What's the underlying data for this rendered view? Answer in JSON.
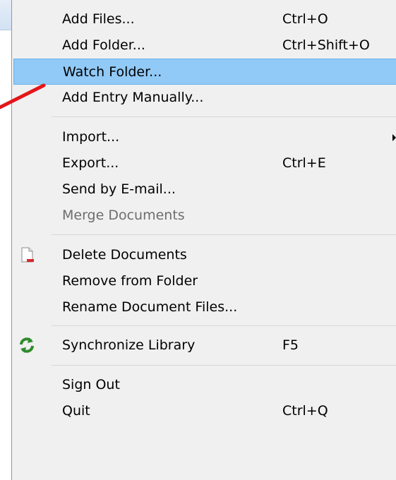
{
  "menu": {
    "items": [
      {
        "label": "Add Files...",
        "shortcut": "Ctrl+O"
      },
      {
        "label": "Add Folder...",
        "shortcut": "Ctrl+Shift+O"
      },
      {
        "label": "Watch Folder...",
        "shortcut": "",
        "state": "highlighted"
      },
      {
        "label": "Add Entry Manually...",
        "shortcut": ""
      },
      {
        "label": "Import...",
        "shortcut": "",
        "submenu": true
      },
      {
        "label": "Export...",
        "shortcut": "Ctrl+E"
      },
      {
        "label": "Send by E-mail...",
        "shortcut": ""
      },
      {
        "label": "Merge Documents",
        "shortcut": "",
        "state": "disabled"
      },
      {
        "label": "Delete Documents",
        "shortcut": "",
        "icon": "delete-document-icon"
      },
      {
        "label": "Remove from Folder",
        "shortcut": ""
      },
      {
        "label": "Rename Document Files...",
        "shortcut": ""
      },
      {
        "label": "Synchronize Library",
        "shortcut": "F5",
        "icon": "sync-icon"
      },
      {
        "label": "Sign Out",
        "shortcut": ""
      },
      {
        "label": "Quit",
        "shortcut": "Ctrl+Q"
      }
    ]
  },
  "colors": {
    "menu_background": "#f0f0f0",
    "highlight": "#91c9f7",
    "highlight_border": "#6cb0ea",
    "separator": "#d7d7d7",
    "disabled_text": "#6d6d6d",
    "pointer_line": "#e3161b",
    "sync_icon": "#2e8b2e"
  }
}
